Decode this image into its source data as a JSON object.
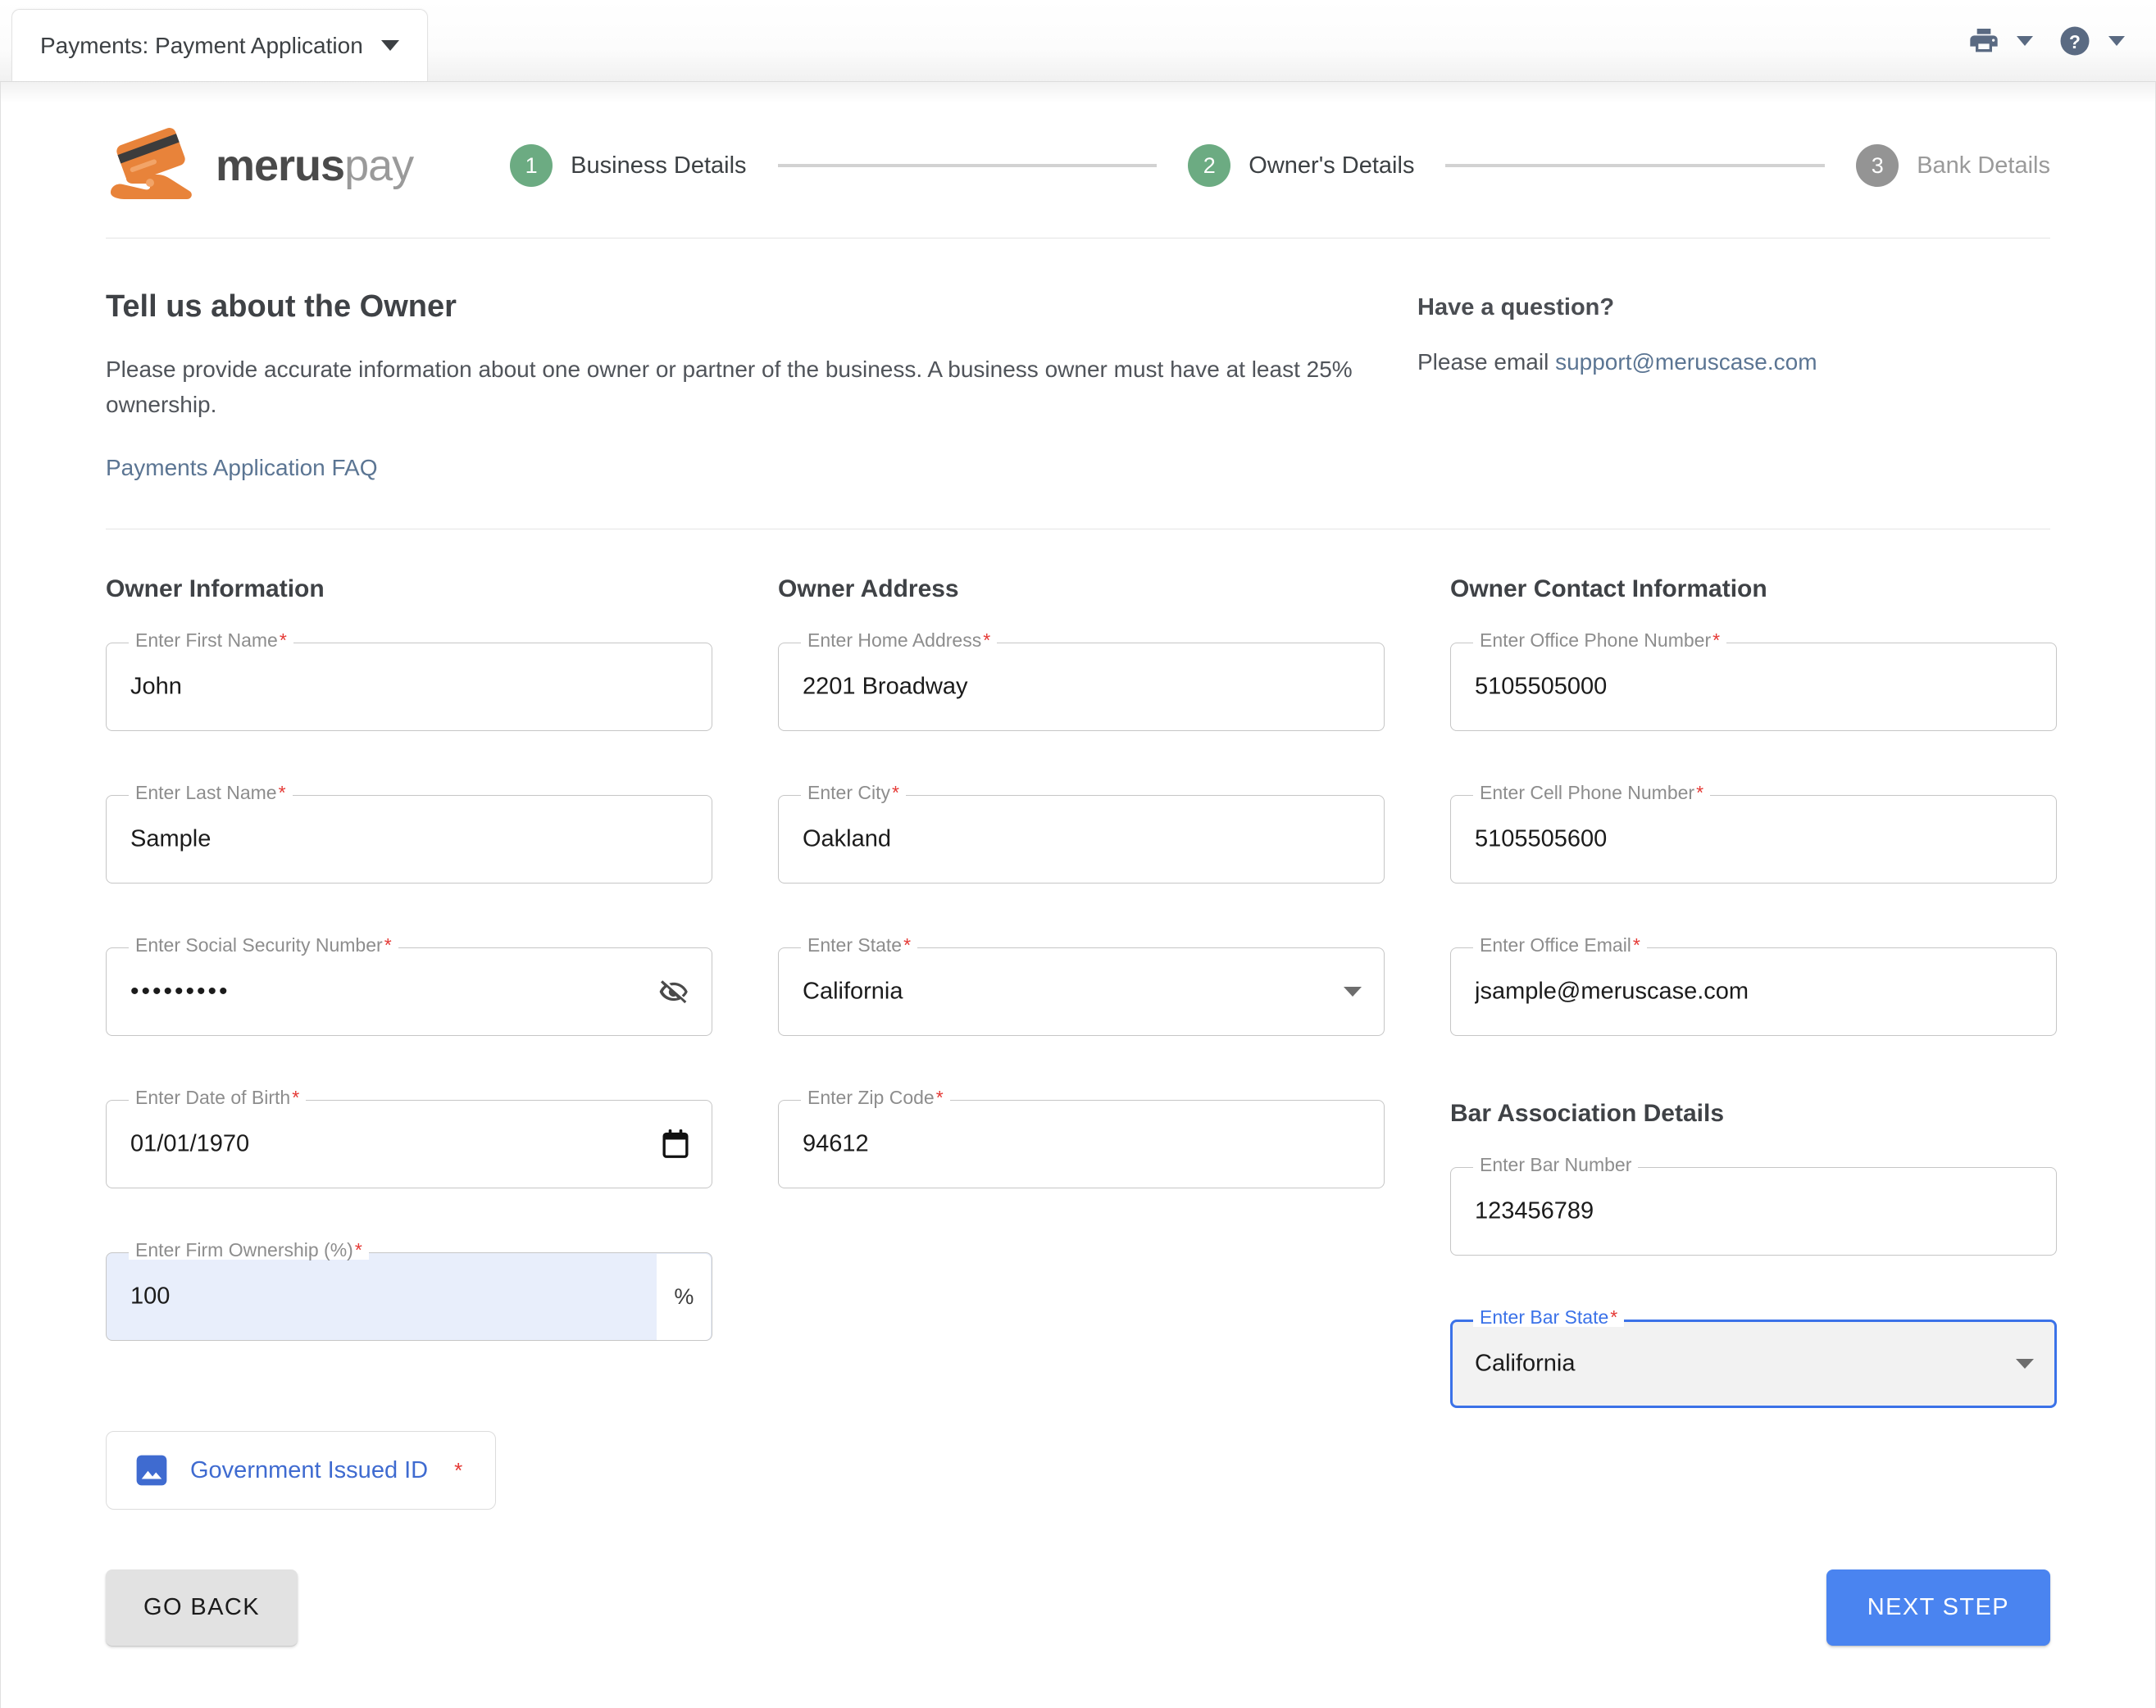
{
  "window": {
    "tab_title": "Payments: Payment Application",
    "print_icon": "printer-icon",
    "help_icon": "help-question-icon"
  },
  "brand": {
    "name_bold": "merus",
    "name_light": "pay",
    "logo_icon": "hand-holding-credit-card-icon"
  },
  "stepper": {
    "steps": [
      {
        "number": "1",
        "label": "Business Details",
        "state": "done"
      },
      {
        "number": "2",
        "label": "Owner's Details",
        "state": "done"
      },
      {
        "number": "3",
        "label": "Bank Details",
        "state": "todo"
      }
    ]
  },
  "intro": {
    "title": "Tell us about the Owner",
    "description": "Please provide accurate information about one owner or partner of the business. A business owner must have at least 25% ownership.",
    "faq_link": "Payments Application FAQ",
    "question_title": "Have a question?",
    "question_prefix": "Please email ",
    "support_email": "support@meruscase.com"
  },
  "sections": {
    "owner_information": {
      "title": "Owner Information",
      "fields": [
        {
          "label": "Enter First Name",
          "required": true,
          "value": "John",
          "type": "text"
        },
        {
          "label": "Enter Last Name",
          "required": true,
          "value": "Sample",
          "type": "text"
        },
        {
          "label": "Enter Social Security Number",
          "required": true,
          "value": "•••••••••",
          "type": "password",
          "trailing_icon": "eye-off-icon"
        },
        {
          "label": "Enter Date of Birth",
          "required": true,
          "value": "01/01/1970",
          "type": "date",
          "trailing_icon": "calendar-icon"
        },
        {
          "label": "Enter Firm Ownership (%)",
          "required": true,
          "value": "100",
          "type": "number",
          "suffix": "%",
          "autofilled": true
        }
      ],
      "upload_button": {
        "label": "Government Issued ID",
        "required_marker": "*",
        "icon": "image-icon"
      }
    },
    "owner_address": {
      "title": "Owner Address",
      "fields": [
        {
          "label": "Enter Home Address",
          "required": true,
          "value": "2201 Broadway",
          "type": "text"
        },
        {
          "label": "Enter City",
          "required": true,
          "value": "Oakland",
          "type": "text"
        },
        {
          "label": "Enter State",
          "required": true,
          "value": "California",
          "type": "select"
        },
        {
          "label": "Enter Zip Code",
          "required": true,
          "value": "94612",
          "type": "text"
        }
      ]
    },
    "owner_contact": {
      "title": "Owner Contact Information",
      "fields": [
        {
          "label": "Enter Office Phone Number",
          "required": true,
          "value": "5105505000",
          "type": "tel"
        },
        {
          "label": "Enter Cell Phone Number",
          "required": true,
          "value": "5105505600",
          "type": "tel"
        },
        {
          "label": "Enter Office Email",
          "required": true,
          "value": "jsample@meruscase.com",
          "type": "email"
        }
      ]
    },
    "bar_association": {
      "title": "Bar Association Details",
      "fields": [
        {
          "label": "Enter Bar Number",
          "required": false,
          "value": "123456789",
          "type": "text"
        },
        {
          "label": "Enter Bar State",
          "required": true,
          "value": "California",
          "type": "select",
          "focused": true
        }
      ]
    }
  },
  "footer": {
    "back_label": "GO BACK",
    "next_label": "NEXT STEP"
  },
  "colors": {
    "step_done": "#6cab82",
    "step_todo": "#949494",
    "primary_button": "#4a84f0",
    "link": "#5b7593",
    "required_asterisk": "#e53935",
    "focus_border": "#3b72e8",
    "autofill_bg": "#e8eefb",
    "brand_orange": "#e8833a"
  }
}
